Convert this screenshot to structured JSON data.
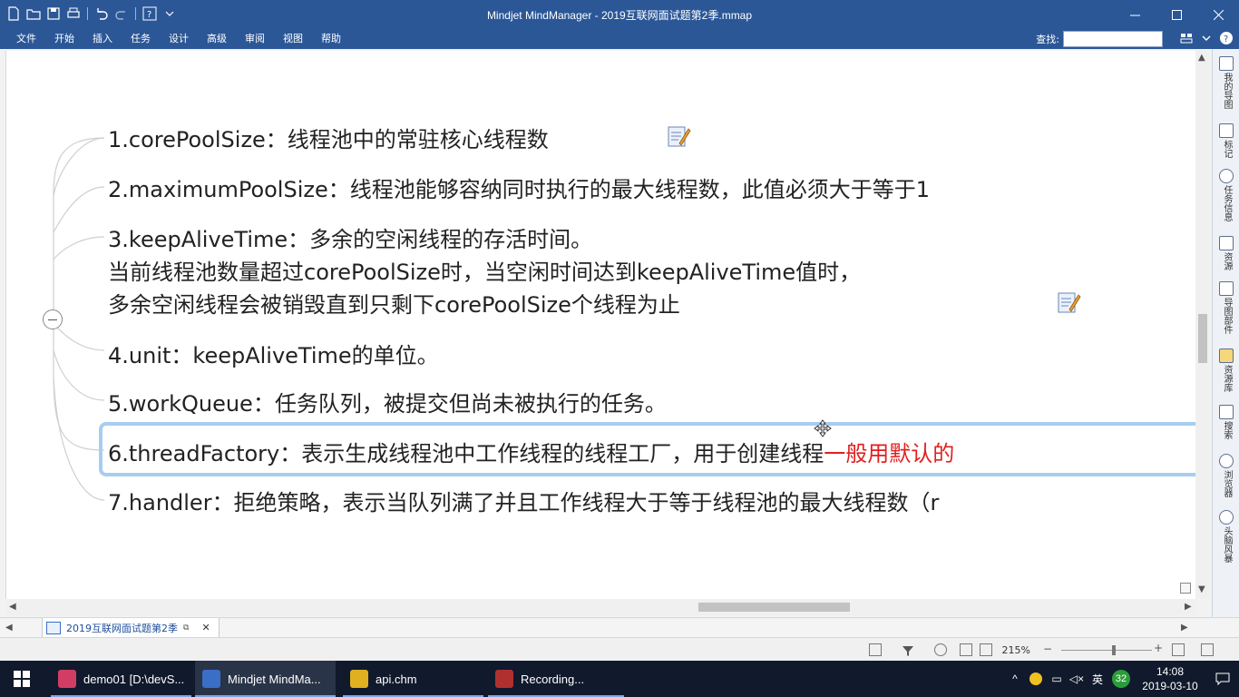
{
  "window": {
    "title": "Mindjet MindManager - 2019互联网面试题第2季.mmap"
  },
  "ribbon": {
    "tabs": [
      "文件",
      "开始",
      "插入",
      "任务",
      "设计",
      "高级",
      "审阅",
      "视图",
      "帮助"
    ],
    "find_label": "查找:",
    "find_value": ""
  },
  "side_panel": {
    "items": [
      "我的导图",
      "标记",
      "任务信息",
      "资源",
      "导图部件",
      "资源库",
      "搜索",
      "浏览器",
      "头脑风暴"
    ]
  },
  "map": {
    "topics": [
      {
        "lines": [
          "1.corePoolSize：线程池中的常驻核心线程数"
        ],
        "has_note": true
      },
      {
        "lines": [
          "2.maximumPoolSize：线程池能够容纳同时执行的最大线程数，此值必须大于等于1"
        ],
        "has_note": false
      },
      {
        "lines": [
          "3.keepAliveTime：多余的空闲线程的存活时间。",
          "当前线程池数量超过corePoolSize时，当空闲时间达到keepAliveTime值时，",
          "多余空闲线程会被销毁直到只剩下corePoolSize个线程为止"
        ],
        "has_note": true
      },
      {
        "lines": [
          "4.unit：keepAliveTime的单位。"
        ],
        "has_note": false
      },
      {
        "lines": [
          "5.workQueue：任务队列，被提交但尚未被执行的任务。"
        ],
        "has_note": false
      },
      {
        "lines": [
          "6.threadFactory：表示生成线程池中工作线程的线程工厂，用于创建线程"
        ],
        "red_suffix": "一般用默认的",
        "selected": true
      },
      {
        "lines": [
          "7.handler：拒绝策略，表示当队列满了并且工作线程大于等于线程池的最大线程数（r"
        ],
        "has_note": false
      }
    ]
  },
  "doc_tab": {
    "label": "2019互联网面试题第2季"
  },
  "status": {
    "zoom": "215%"
  },
  "taskbar": {
    "apps": [
      {
        "label": "demo01 [D:\\devS...",
        "color": "#d23d63"
      },
      {
        "label": "Mindjet MindMa...",
        "color": "#3a6fc8"
      },
      {
        "label": "api.chm",
        "color": "#e0b020"
      },
      {
        "label": "Recording...",
        "color": "#b03030"
      }
    ],
    "ime": "英",
    "badge": "32",
    "time": "14:08",
    "date": "2019-03-10"
  }
}
